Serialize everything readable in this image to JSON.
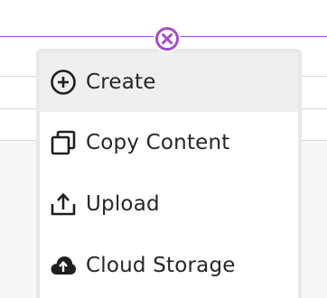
{
  "colors": {
    "accent": "#a44cc7",
    "menu_active_bg": "#efefef",
    "text": "#262626"
  },
  "close_button": {
    "icon": "close-circle-icon"
  },
  "menu": {
    "items": [
      {
        "label": "Create",
        "icon": "add-circle-icon",
        "active": true
      },
      {
        "label": "Copy Content",
        "icon": "copy-icon",
        "active": false
      },
      {
        "label": "Upload",
        "icon": "upload-icon",
        "active": false
      },
      {
        "label": "Cloud Storage",
        "icon": "cloud-upload-icon",
        "active": false
      }
    ]
  }
}
